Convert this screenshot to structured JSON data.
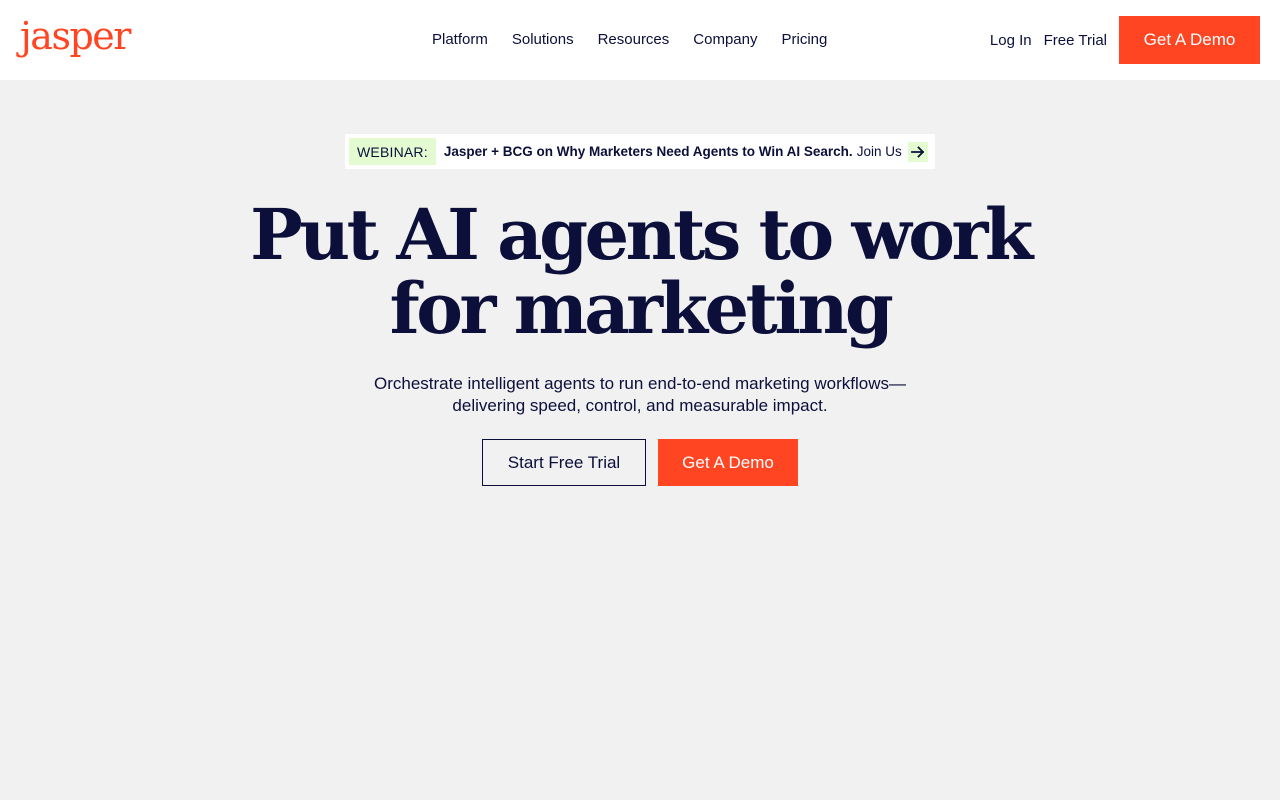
{
  "brand": {
    "logo_text": "jasper",
    "accent_color": "#ff4522",
    "text_color": "#0b0f3a",
    "banner_tag_color": "#e4fbd2",
    "background_color": "#f1f1f1"
  },
  "header": {
    "nav": [
      {
        "label": "Platform"
      },
      {
        "label": "Solutions"
      },
      {
        "label": "Resources"
      },
      {
        "label": "Company"
      },
      {
        "label": "Pricing"
      }
    ],
    "login_label": "Log In",
    "free_trial_label": "Free Trial",
    "demo_label": "Get A Demo"
  },
  "banner": {
    "tag": "WEBINAR:",
    "text": "Jasper + BCG on Why Marketers Need Agents to Win AI Search.",
    "cta": "Join Us",
    "icon": "arrow-right-icon"
  },
  "hero": {
    "headline_line1": "Put AI agents to work",
    "headline_line2": "for marketing",
    "subhead_line1": "Orchestrate intelligent agents to run end-to-end marketing workflows—",
    "subhead_line2": "delivering speed, control, and measurable impact.",
    "primary_cta": "Start Free Trial",
    "secondary_cta": "Get A Demo"
  }
}
